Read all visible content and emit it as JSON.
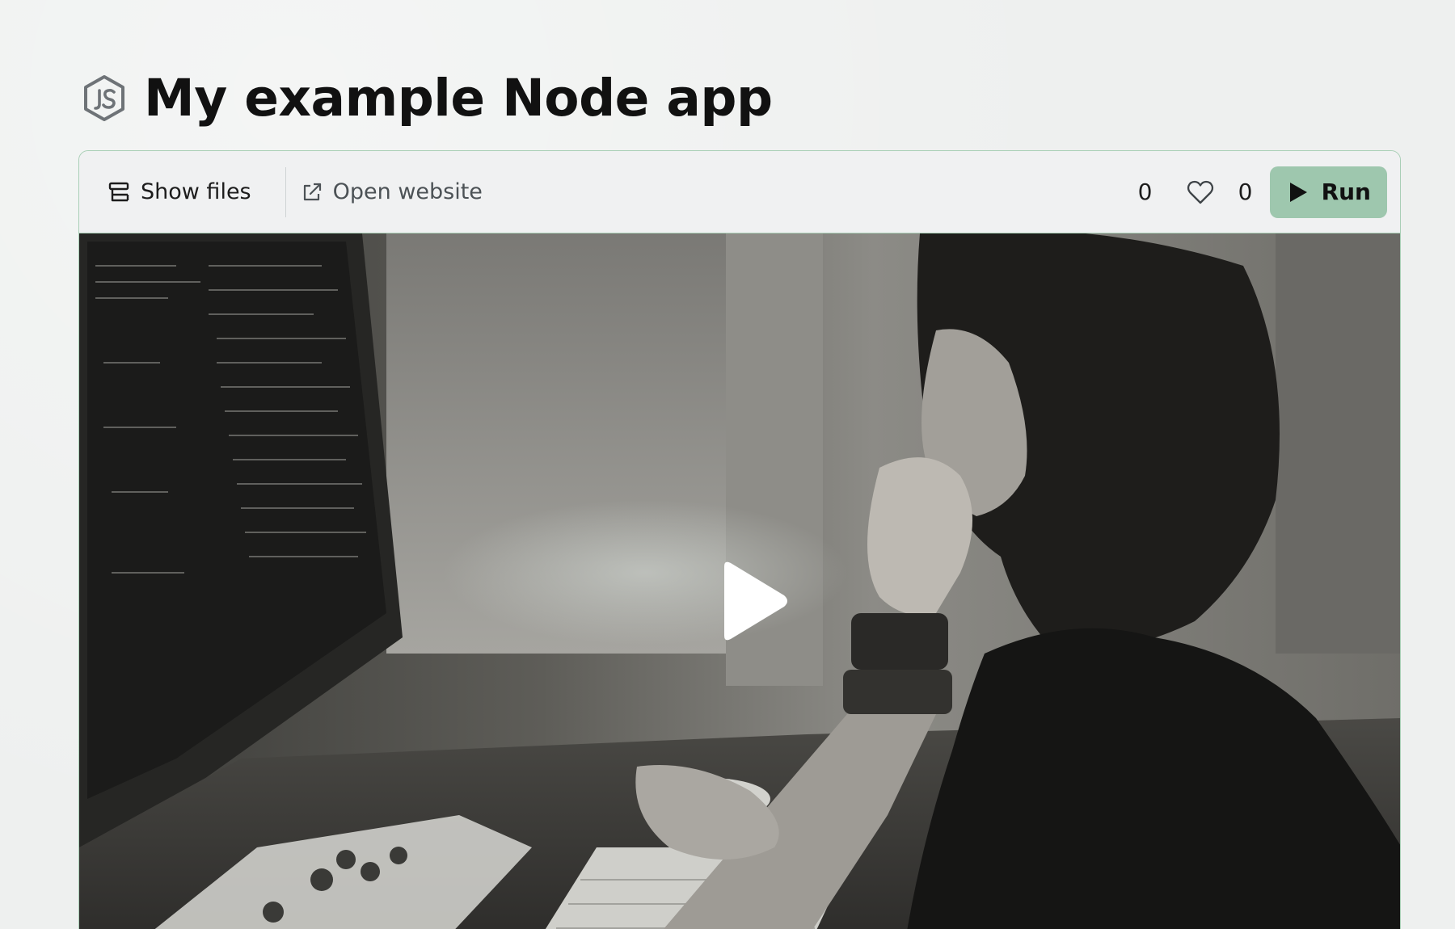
{
  "project": {
    "title": "My example Node app",
    "logo_icon": "nodejs-icon"
  },
  "toolbar": {
    "show_files_label": "Show files",
    "show_files_icon": "files-icon",
    "open_website_label": "Open website",
    "open_website_icon": "external-link-icon",
    "views_count": "0",
    "like_icon": "heart-icon",
    "likes_count": "0",
    "run_label": "Run",
    "run_icon": "play-icon"
  },
  "preview": {
    "type": "video-thumbnail",
    "play_icon": "play-icon"
  },
  "colors": {
    "page_background": "#eef0ef",
    "card_border": "#a9cfb6",
    "run_button": "#9ec7ae"
  }
}
